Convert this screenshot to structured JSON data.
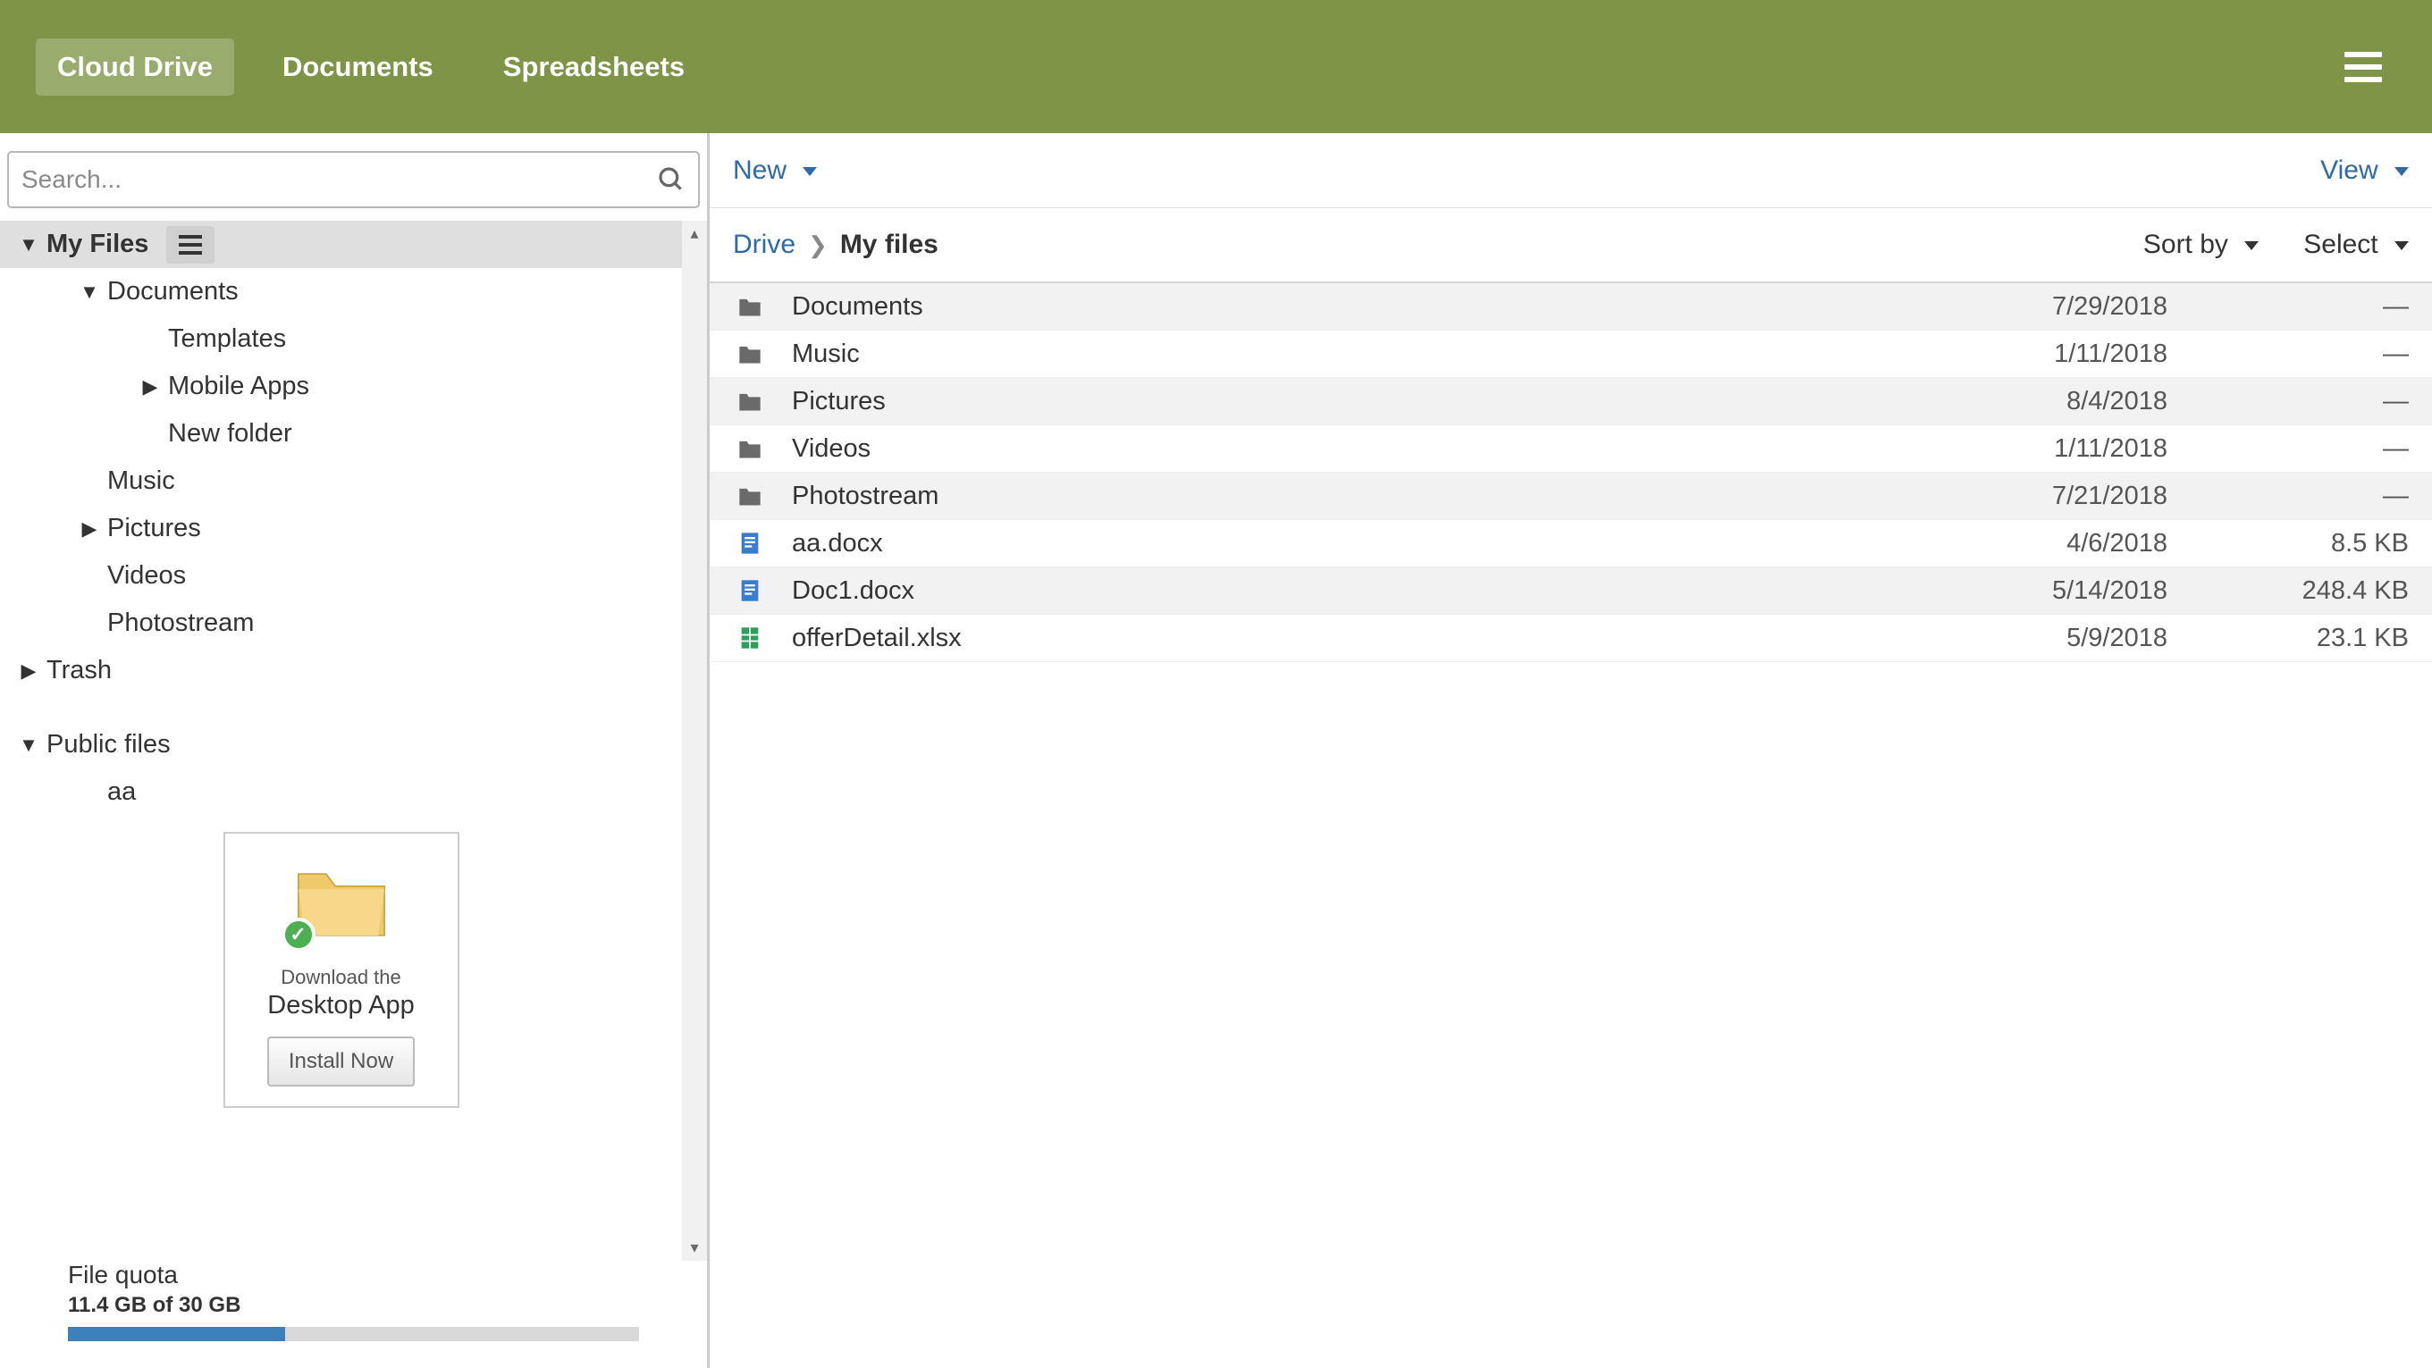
{
  "topbar": {
    "tabs": [
      "Cloud Drive",
      "Documents",
      "Spreadsheets"
    ],
    "active_index": 0
  },
  "sidebar": {
    "search_placeholder": "Search...",
    "tree": {
      "root_label": "My Files",
      "documents": "Documents",
      "templates": "Templates",
      "mobile_apps": "Mobile Apps",
      "new_folder": "New folder",
      "music": "Music",
      "pictures": "Pictures",
      "videos": "Videos",
      "photostream": "Photostream",
      "trash": "Trash",
      "public_files": "Public files",
      "aa": "aa"
    },
    "download_card": {
      "subtitle": "Download the",
      "title": "Desktop App",
      "button": "Install Now"
    },
    "quota": {
      "label": "File quota",
      "text": "11.4 GB of 30 GB",
      "percent": 38
    }
  },
  "toolbar": {
    "new_label": "New",
    "view_label": "View"
  },
  "breadcrumb": {
    "root": "Drive",
    "current": "My files",
    "sort_label": "Sort by",
    "select_label": "Select"
  },
  "files": [
    {
      "name": "Documents",
      "date": "7/29/2018",
      "size": "—",
      "icon": "folder"
    },
    {
      "name": "Music",
      "date": "1/11/2018",
      "size": "—",
      "icon": "folder"
    },
    {
      "name": "Pictures",
      "date": "8/4/2018",
      "size": "—",
      "icon": "folder"
    },
    {
      "name": "Videos",
      "date": "1/11/2018",
      "size": "—",
      "icon": "folder"
    },
    {
      "name": "Photostream",
      "date": "7/21/2018",
      "size": "—",
      "icon": "folder"
    },
    {
      "name": "aa.docx",
      "date": "4/6/2018",
      "size": "8.5 KB",
      "icon": "doc"
    },
    {
      "name": "Doc1.docx",
      "date": "5/14/2018",
      "size": "248.4 KB",
      "icon": "doc"
    },
    {
      "name": "offerDetail.xlsx",
      "date": "5/9/2018",
      "size": "23.1 KB",
      "icon": "sheet"
    }
  ],
  "colors": {
    "topbar_bg": "#7e9446",
    "link": "#2e6aa6",
    "quota_fill": "#3d7fb8"
  }
}
